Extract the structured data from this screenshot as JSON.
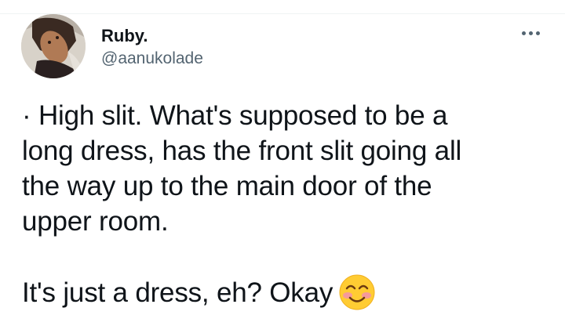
{
  "author": {
    "display_name": "Ruby.",
    "handle": "@aanukolade",
    "avatar_icon": "profile-photo"
  },
  "tweet": {
    "paragraph_1": "· High slit. What's supposed to be a\nlong dress, has the front slit going all\nthe way up to the main door of the\nupper room.",
    "paragraph_2": "It's just a dress, eh? Okay",
    "emoji": "smiling-face-with-smiling-eyes-icon"
  },
  "menu": {
    "more_icon": "more-options-icon"
  },
  "colors": {
    "text_primary": "#0f1419",
    "text_secondary": "#536471",
    "divider": "#eff3f4",
    "emoji_face": "#ffcc33"
  }
}
